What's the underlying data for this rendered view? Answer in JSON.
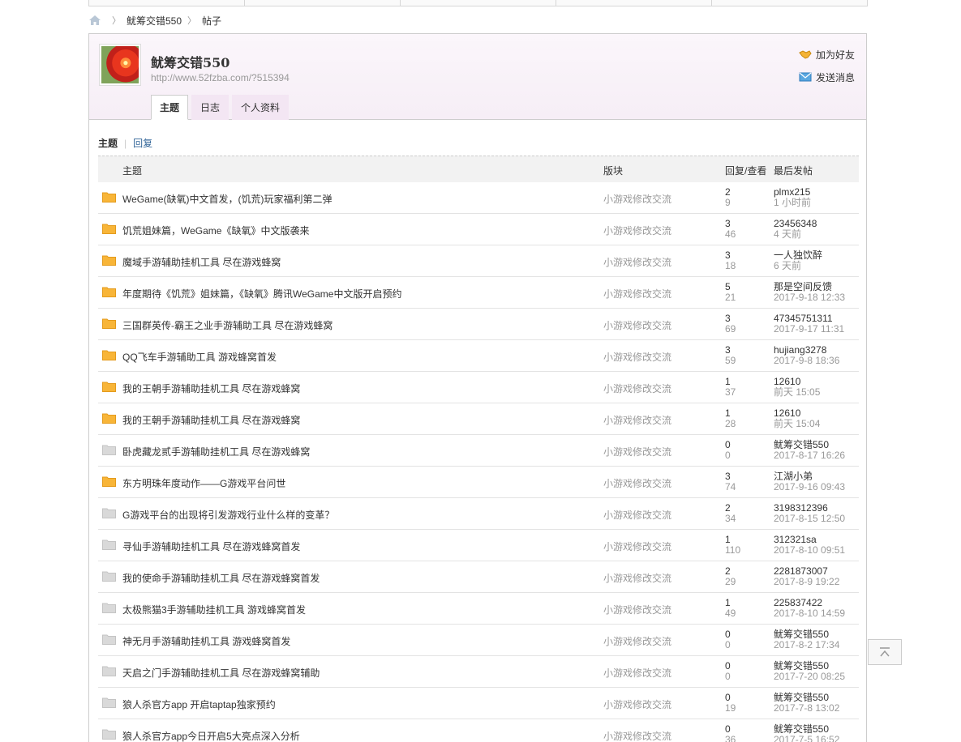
{
  "breadcrumb": {
    "home_icon": "home-icon",
    "user": "鱿筹交错550",
    "section": "帖子"
  },
  "profile": {
    "username": "鱿筹交错550",
    "url": "http://www.52fzba.com/?515394",
    "add_friend": "加为好友",
    "send_message": "发送消息",
    "tabs": [
      {
        "label": "主题",
        "active": true
      },
      {
        "label": "日志",
        "active": false
      },
      {
        "label": "个人资料",
        "active": false
      }
    ]
  },
  "subtabs": {
    "topics": "主题",
    "sep": "|",
    "replies": "回复"
  },
  "table": {
    "headers": {
      "topic": "主题",
      "forum": "版块",
      "replies_views": "回复/查看",
      "last_post": "最后发帖"
    },
    "rows": [
      {
        "title": "WeGame(缺氧)中文首发，(饥荒)玩家福利第二弹",
        "forum": "小游戏修改交流",
        "replies": "2",
        "views": "9",
        "author": "plmx215",
        "time": "1 小时前",
        "hot": true
      },
      {
        "title": "饥荒姐妹篇，WeGame《缺氧》中文版袭来",
        "forum": "小游戏修改交流",
        "replies": "3",
        "views": "46",
        "author": "23456348",
        "time": "4 天前",
        "hot": true
      },
      {
        "title": "魔域手游辅助挂机工具 尽在游戏蜂窝",
        "forum": "小游戏修改交流",
        "replies": "3",
        "views": "18",
        "author": "一人独饮醉",
        "time": "6 天前",
        "hot": true
      },
      {
        "title": "年度期待《饥荒》姐妹篇，《缺氧》腾讯WeGame中文版开启预约",
        "forum": "小游戏修改交流",
        "replies": "5",
        "views": "21",
        "author": "那是空间反馈",
        "time": "2017-9-18 12:33",
        "hot": true
      },
      {
        "title": "三国群英传-霸王之业手游辅助工具 尽在游戏蜂窝",
        "forum": "小游戏修改交流",
        "replies": "3",
        "views": "69",
        "author": "47345751311",
        "time": "2017-9-17 11:31",
        "hot": true
      },
      {
        "title": "QQ飞车手游辅助工具 游戏蜂窝首发",
        "forum": "小游戏修改交流",
        "replies": "3",
        "views": "59",
        "author": "hujiang3278",
        "time": "2017-9-8 18:36",
        "hot": true
      },
      {
        "title": "我的王朝手游辅助挂机工具 尽在游戏蜂窝",
        "forum": "小游戏修改交流",
        "replies": "1",
        "views": "37",
        "author": "12610",
        "time": "前天 15:05",
        "hot": true
      },
      {
        "title": "我的王朝手游辅助挂机工具 尽在游戏蜂窝",
        "forum": "小游戏修改交流",
        "replies": "1",
        "views": "28",
        "author": "12610",
        "time": "前天 15:04",
        "hot": true
      },
      {
        "title": "卧虎藏龙贰手游辅助挂机工具 尽在游戏蜂窝",
        "forum": "小游戏修改交流",
        "replies": "0",
        "views": "0",
        "author": "鱿筹交错550",
        "time": "2017-8-17 16:26",
        "hot": false
      },
      {
        "title": "东方明珠年度动作——G游戏平台问世",
        "forum": "小游戏修改交流",
        "replies": "3",
        "views": "74",
        "author": "江湖小弟",
        "time": "2017-9-16 09:43",
        "hot": true
      },
      {
        "title": "G游戏平台的出现将引发游戏行业什么样的变革？",
        "forum": "小游戏修改交流",
        "replies": "2",
        "views": "34",
        "author": "3198312396",
        "time": "2017-8-15 12:50",
        "hot": false
      },
      {
        "title": "寻仙手游辅助挂机工具 尽在游戏蜂窝首发",
        "forum": "小游戏修改交流",
        "replies": "1",
        "views": "110",
        "author": "312321sa",
        "time": "2017-8-10 09:51",
        "hot": false
      },
      {
        "title": "我的使命手游辅助挂机工具 尽在游戏蜂窝首发",
        "forum": "小游戏修改交流",
        "replies": "2",
        "views": "29",
        "author": "2281873007",
        "time": "2017-8-9 19:22",
        "hot": false
      },
      {
        "title": "太极熊猫3手游辅助挂机工具 游戏蜂窝首发",
        "forum": "小游戏修改交流",
        "replies": "1",
        "views": "49",
        "author": "225837422",
        "time": "2017-8-10 14:59",
        "hot": false
      },
      {
        "title": "神无月手游辅助挂机工具 游戏蜂窝首发",
        "forum": "小游戏修改交流",
        "replies": "0",
        "views": "0",
        "author": "鱿筹交错550",
        "time": "2017-8-2 17:34",
        "hot": false
      },
      {
        "title": "天启之门手游辅助挂机工具 尽在游戏蜂窝辅助",
        "forum": "小游戏修改交流",
        "replies": "0",
        "views": "0",
        "author": "鱿筹交错550",
        "time": "2017-7-20 08:25",
        "hot": false
      },
      {
        "title": "狼人杀官方app 开启taptap独家预约",
        "forum": "小游戏修改交流",
        "replies": "0",
        "views": "19",
        "author": "鱿筹交错550",
        "time": "2017-7-8 13:02",
        "hot": false
      },
      {
        "title": "狼人杀官方app今日开启5大亮点深入分析",
        "forum": "小游戏修改交流",
        "replies": "0",
        "views": "36",
        "author": "鱿筹交错550",
        "time": "2017-7-5 16:52",
        "hot": false
      }
    ]
  },
  "colors": {
    "hot_folder": "#f8b538",
    "cold_folder": "#d9d9d9",
    "link": "#336699",
    "profile_bg": "#f6eef6"
  },
  "back_to_top": {
    "icon": "back-to-top-icon"
  }
}
